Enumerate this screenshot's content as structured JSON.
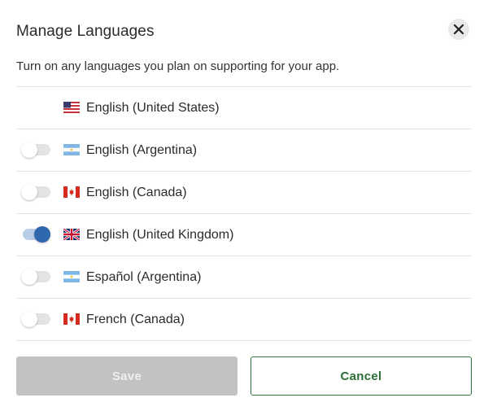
{
  "dialog": {
    "title": "Manage Languages",
    "subtitle": "Turn on any languages you plan on supporting for your app."
  },
  "languages": [
    {
      "label": "English (United States)",
      "flag": "us-flag-icon",
      "has_toggle": false,
      "enabled": true
    },
    {
      "label": "English (Argentina)",
      "flag": "argentina-flag-icon",
      "has_toggle": true,
      "enabled": false
    },
    {
      "label": "English (Canada)",
      "flag": "canada-flag-icon",
      "has_toggle": true,
      "enabled": false
    },
    {
      "label": "English (United Kingdom)",
      "flag": "uk-flag-icon",
      "has_toggle": true,
      "enabled": true
    },
    {
      "label": "Español (Argentina)",
      "flag": "argentina-flag-icon",
      "has_toggle": true,
      "enabled": false
    },
    {
      "label": "French (Canada)",
      "flag": "canada-flag-icon",
      "has_toggle": true,
      "enabled": false
    }
  ],
  "actions": {
    "save_label": "Save",
    "cancel_label": "Cancel"
  },
  "colors": {
    "toggle_on_knob": "#2f68ad",
    "toggle_on_track": "#b8cde6",
    "cancel_border": "#2f7a3c",
    "save_disabled_bg": "#c2c2c2"
  }
}
